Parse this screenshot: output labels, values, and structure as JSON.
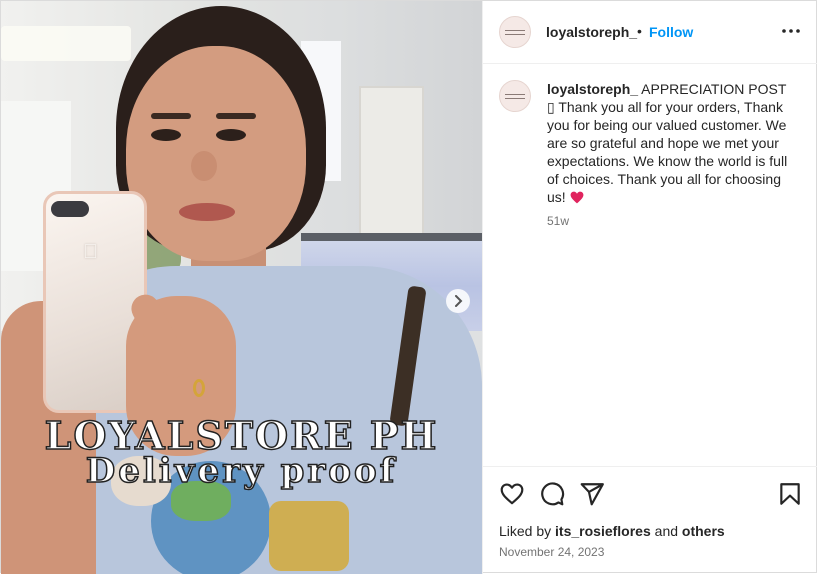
{
  "media": {
    "overlay_line1": "LOYALSTORE PH",
    "overlay_line2": "Delivery proof",
    "next_icon": "chevron-right-icon"
  },
  "header": {
    "username": "loyalstoreph_",
    "separator": "•",
    "follow_label": "Follow",
    "more_icon": "more-horizontal-icon"
  },
  "caption": {
    "username": "loyalstoreph_",
    "text": "APPRECIATION POST ▯ Thank you all for your orders, Thank you for being our valued customer. We are so grateful and hope we met your expectations. We know the world is full of choices. Thank you all for choosing us!",
    "emoji": "red-heart",
    "time_ago": "51w"
  },
  "actions": {
    "like_icon": "heart-icon",
    "comment_icon": "comment-icon",
    "share_icon": "send-icon",
    "save_icon": "bookmark-icon"
  },
  "likes": {
    "prefix": "Liked by",
    "user": "its_rosieflores",
    "joiner": "and",
    "others": "others"
  },
  "date": "November 24, 2023",
  "colors": {
    "follow": "#0095f6",
    "heart": "#e0245e",
    "text": "#262626",
    "muted": "#737373"
  }
}
